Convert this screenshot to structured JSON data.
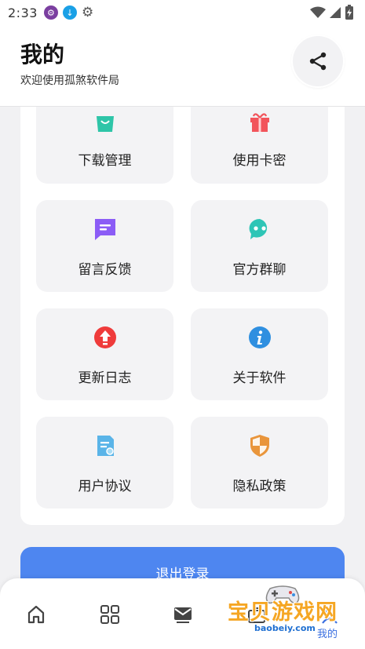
{
  "status_bar": {
    "time": "2:33"
  },
  "header": {
    "title": "我的",
    "subtitle": "欢迎使用孤煞软件局"
  },
  "menu": [
    {
      "label": "下载管理",
      "icon": "shopping-bag-icon",
      "color": "#2ec5a8"
    },
    {
      "label": "使用卡密",
      "icon": "gift-icon",
      "color": "#f2545b"
    },
    {
      "label": "留言反馈",
      "icon": "message-icon",
      "color": "#8b5cf6"
    },
    {
      "label": "官方群聊",
      "icon": "chat-bot-icon",
      "color": "#2ec5b6"
    },
    {
      "label": "更新日志",
      "icon": "upload-icon",
      "color": "#ef3b3b"
    },
    {
      "label": "关于软件",
      "icon": "info-icon",
      "color": "#2f8fe0"
    },
    {
      "label": "用户协议",
      "icon": "document-icon",
      "color": "#5ab4e8"
    },
    {
      "label": "隐私政策",
      "icon": "shield-icon",
      "color": "#e9953b"
    }
  ],
  "logout_label": "退出登录",
  "bottom_nav": {
    "items": [
      {
        "name": "home-icon"
      },
      {
        "name": "apps-icon"
      },
      {
        "name": "mail-icon"
      },
      {
        "name": "bag-icon"
      },
      {
        "name": "profile-icon"
      }
    ],
    "active_label": "我的"
  },
  "watermark": {
    "text": "宝贝游戏网",
    "url": "baobeiy.com"
  },
  "colors": {
    "accent": "#4e86f0",
    "background": "#f1f1f3",
    "tile": "#f3f3f5"
  }
}
